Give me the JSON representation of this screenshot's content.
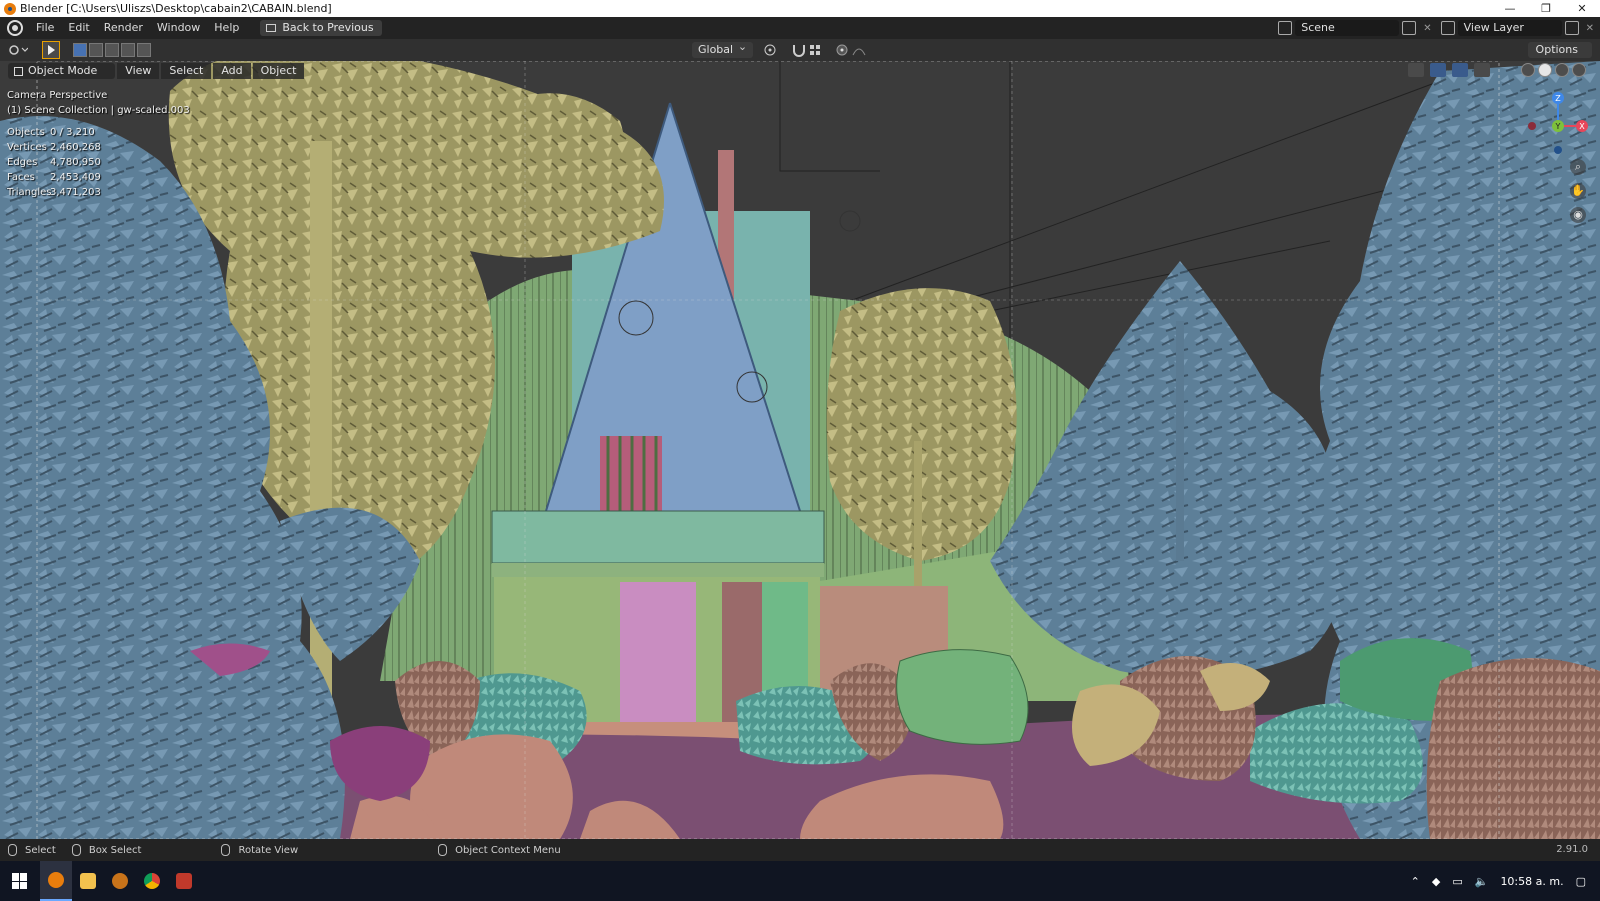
{
  "window": {
    "title": "Blender [C:\\Users\\Uliszs\\Desktop\\cabain2\\CABAIN.blend]",
    "controls": [
      "—",
      "❐",
      "✕"
    ]
  },
  "menubar": {
    "items": [
      "File",
      "Edit",
      "Render",
      "Window",
      "Help"
    ],
    "back_button": "Back to Previous",
    "scene": "Scene",
    "view_layer": "View Layer"
  },
  "toolheader": {
    "orientation": "Global",
    "options": "Options"
  },
  "viewport": {
    "mode": "Object Mode",
    "menus": [
      "View",
      "Select",
      "Add",
      "Object"
    ],
    "camera_label": "Camera Perspective",
    "collection_label": "(1) Scene Collection | gw-scaled.003",
    "stats": [
      {
        "key": "Objects",
        "value": "0 / 3,210"
      },
      {
        "key": "Vertices",
        "value": "2,460,268"
      },
      {
        "key": "Edges",
        "value": "4,780,950"
      },
      {
        "key": "Faces",
        "value": "2,453,409"
      },
      {
        "key": "Triangles",
        "value": "3,471,203"
      }
    ],
    "gizmo": {
      "z": "Z",
      "y": "Y",
      "x": "X"
    }
  },
  "statusbar": {
    "select": "Select",
    "box_select": "Box Select",
    "rotate_view": "Rotate View",
    "context_menu": "Object Context Menu",
    "version": "2.91.0"
  },
  "taskbar": {
    "time": "10:58 a. m."
  },
  "colors": {
    "accent": "#4772b3",
    "active_tool": "#e8a000",
    "gizmo_x": "#e8465a",
    "gizmo_y": "#7ec23a",
    "gizmo_z": "#3f88e8"
  }
}
